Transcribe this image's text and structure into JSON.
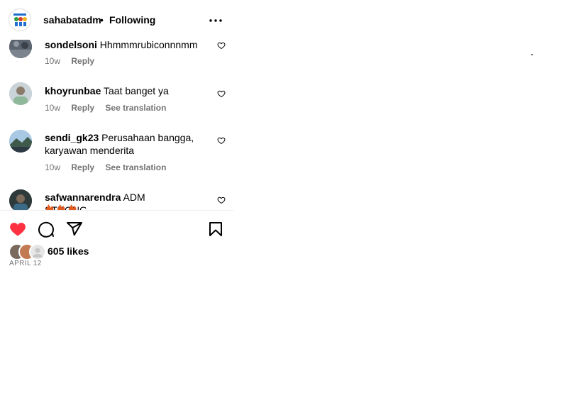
{
  "header": {
    "username": "sahabatadm",
    "separator": "•",
    "follow_status": "Following",
    "avatar_icon": "logo-icon",
    "more_icon": "more-options-icon"
  },
  "comments": [
    {
      "username": "sondelsoni",
      "text": "Hhmmmrubiconnnmm",
      "age": "10w",
      "reply": "Reply",
      "translate": ""
    },
    {
      "username": "khoyrunbae",
      "text": "Taat banget ya",
      "age": "10w",
      "reply": "Reply",
      "translate": "See translation"
    },
    {
      "username": "sendi_gk23",
      "text": "Perusahaan bangga, karyawan menderita",
      "age": "10w",
      "reply": "Reply",
      "translate": "See translation"
    },
    {
      "username": "safwannarendra",
      "text": "ADM STRONG......",
      "age": "",
      "reply": "",
      "translate": ""
    }
  ],
  "actions": {
    "like_icon": "heart-filled-icon",
    "comment_icon": "comment-icon",
    "share_icon": "send-icon",
    "save_icon": "bookmark-icon",
    "like_color": "#ff3040"
  },
  "likes": {
    "label": "605 likes"
  },
  "post_date": "APRIL 12"
}
